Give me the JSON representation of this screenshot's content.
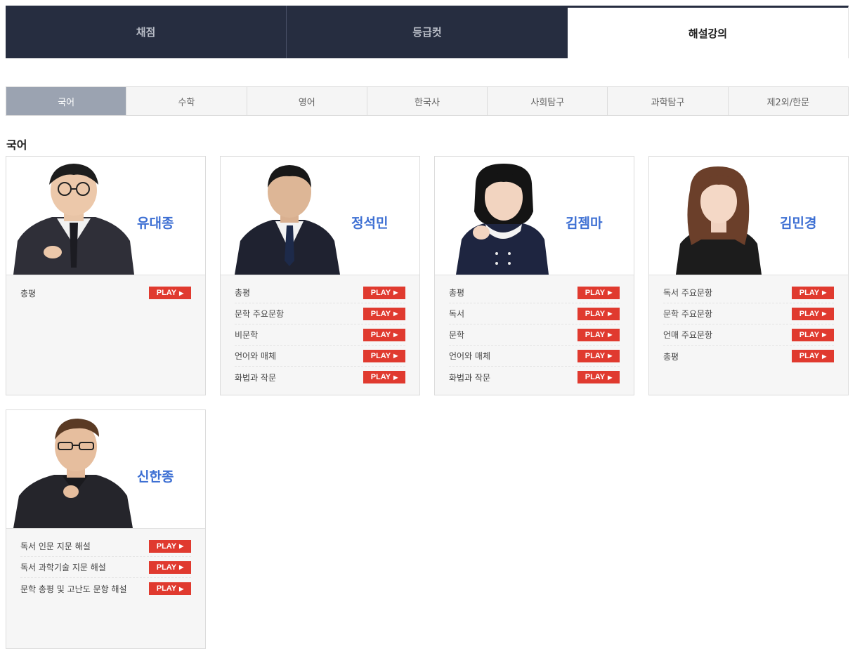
{
  "top_tabs": [
    "채점",
    "등급컷",
    "해설강의"
  ],
  "subject_tabs": [
    "국어",
    "수학",
    "영어",
    "한국사",
    "사회탐구",
    "과학탐구",
    "제2외/한문"
  ],
  "section_title": "국어",
  "play_label": "PLAY",
  "play_arrow": "▶",
  "accent_colors": {
    "nav_dark": "#262d40",
    "play_red": "#e03a2f",
    "name_blue": "#3d6fd3",
    "active_subject": "#9ba3b1"
  },
  "teachers": [
    {
      "name": "유대종",
      "lectures": [
        "총평"
      ]
    },
    {
      "name": "정석민",
      "lectures": [
        "총평",
        "문학 주요문항",
        "비문학",
        "언어와 매체",
        "화법과 작문"
      ]
    },
    {
      "name": "김젬마",
      "lectures": [
        "총평",
        "독서",
        "문학",
        "언어와 매체",
        "화법과 작문"
      ]
    },
    {
      "name": "김민경",
      "lectures": [
        "독서 주요문항",
        "문학 주요문항",
        "언매 주요문항",
        "총평"
      ]
    },
    {
      "name": "신한종",
      "lectures": [
        "독서 인문 지문 해설",
        "독서 과학기술 지문 해설",
        "문학 총평 및 고난도 문항 해설"
      ]
    }
  ]
}
